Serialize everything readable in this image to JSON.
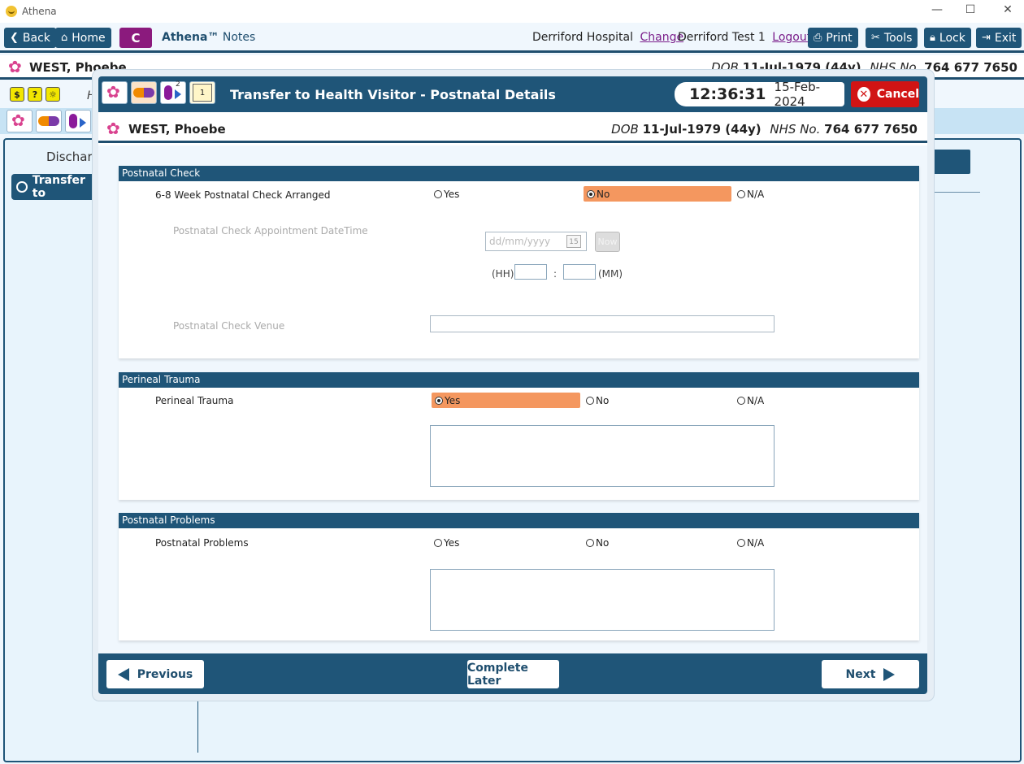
{
  "window": {
    "title": "Athena"
  },
  "toolbar": {
    "back": "Back",
    "home": "Home",
    "c_button": "C",
    "app_name": "Athena™",
    "app_section": "Notes",
    "hospital": "Derriford Hospital",
    "change_link": "Change",
    "user": "Derriford Test 1",
    "logout_link": "Logout",
    "print": "Print",
    "tools": "Tools",
    "lock": "Lock",
    "exit": "Exit"
  },
  "patient": {
    "name": "WEST, Phoebe",
    "dob_label": "DOB",
    "dob": "11-Jul-1979 (44y)",
    "nhs_label": "NHS No.",
    "nhs": "764 677 7650"
  },
  "background": {
    "row_letter": "H",
    "discharge_label": "Discharg",
    "nav_item": "Transfer to"
  },
  "modal": {
    "title": "Transfer to Health Visitor - Postnatal Details",
    "time": "12:36:31",
    "date": "15-Feb-2024",
    "cancel": "Cancel",
    "note_count": "1",
    "transfer_count": "2"
  },
  "sections": {
    "postnatal_check": {
      "header": "Postnatal Check",
      "question": "6-8 Week Postnatal Check Arranged",
      "options": [
        "Yes",
        "No",
        "N/A"
      ],
      "selected": "No",
      "appointment_label": "Postnatal Check Appointment DateTime",
      "date_placeholder": "dd/mm/yyyy",
      "cal_day": "15",
      "now_button": "Now",
      "hh_label": "(HH)",
      "colon": ":",
      "mm_label": "(MM)",
      "venue_label": "Postnatal Check Venue"
    },
    "perineal_trauma": {
      "header": "Perineal Trauma",
      "question": "Perineal Trauma",
      "options": [
        "Yes",
        "No",
        "N/A"
      ],
      "selected": "Yes"
    },
    "postnatal_problems": {
      "header": "Postnatal Problems",
      "question": "Postnatal Problems",
      "options": [
        "Yes",
        "No",
        "N/A"
      ],
      "selected": ""
    }
  },
  "footer": {
    "previous": "Previous",
    "complete_later": "Complete Later",
    "next": "Next"
  },
  "colors": {
    "primary": "#1f5578",
    "selected_option": "#f4975f",
    "cancel": "#d11414",
    "c_button": "#8b1a7d"
  }
}
